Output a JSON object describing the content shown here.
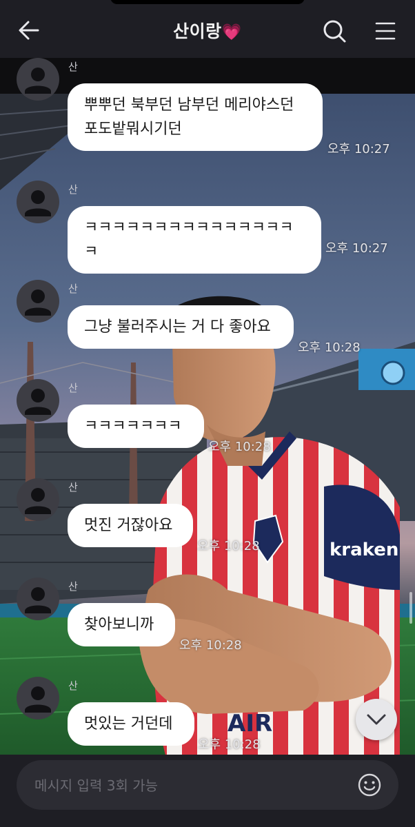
{
  "header": {
    "title": "산이랑",
    "title_emoji": "💗",
    "back_icon": "arrow-left-icon",
    "search_icon": "search-icon",
    "menu_icon": "hamburger-menu-icon"
  },
  "messages": [
    {
      "sender": "산",
      "text": "뿌뿌던 북부던 남부던 메리야스던\n포도밭뭐시기던",
      "time": "오후 10:27"
    },
    {
      "sender": "산",
      "text": "ㅋㅋㅋㅋㅋㅋㅋㅋㅋㅋㅋㅋㅋㅋㅋㅋ",
      "time": "오후 10:27"
    },
    {
      "sender": "산",
      "text": "그냥 불러주시는 거 다 좋아요",
      "time": "오후 10:28"
    },
    {
      "sender": "산",
      "text": "ㅋㅋㅋㅋㅋㅋㅋ",
      "time": "오후 10:28"
    },
    {
      "sender": "산",
      "text": "멋진 거잖아요",
      "time": "오후 10:28"
    },
    {
      "sender": "산",
      "text": "찾아보니까",
      "time": "오후 10:28"
    },
    {
      "sender": "산",
      "text": "멋있는 거던데",
      "time": "오후 10:28"
    }
  ],
  "background": {
    "jersey_sponsor_wordmark": "kraken",
    "jersey_chest_text": "AIR",
    "stadium_sky": "dusk"
  },
  "input": {
    "placeholder": "메시지 입력 3회 가능",
    "emoji_icon": "smiley-icon"
  },
  "scroll_down_icon": "chevron-down-icon",
  "colors": {
    "header_bg": "#1e1e24",
    "bubble_bg": "#ffffff",
    "heart": "#ff4fb8",
    "input_bg": "#2c2c33"
  }
}
